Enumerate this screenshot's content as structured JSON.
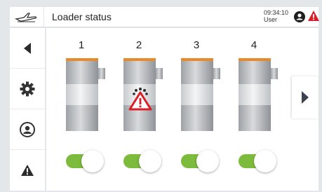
{
  "header": {
    "title": "Loader status",
    "time": "09:34:10",
    "user_label": "User",
    "logo_icon": "plane-logo-icon",
    "user_icon": "user-icon",
    "alert_icon": "alert-icon"
  },
  "nav": {
    "items": [
      {
        "icon": "back-arrow-icon"
      },
      {
        "icon": "gear-icon"
      },
      {
        "icon": "service-icon"
      },
      {
        "icon": "warning-icon"
      }
    ]
  },
  "loaders": [
    {
      "number": "1",
      "alarm": false,
      "enabled": true
    },
    {
      "number": "2",
      "alarm": true,
      "enabled": true
    },
    {
      "number": "3",
      "alarm": false,
      "enabled": true
    },
    {
      "number": "4",
      "alarm": false,
      "enabled": true
    }
  ],
  "colors": {
    "accent_orange": "#e8892b",
    "toggle_green": "#7dbb3c",
    "alarm_red": "#d91e2a"
  }
}
